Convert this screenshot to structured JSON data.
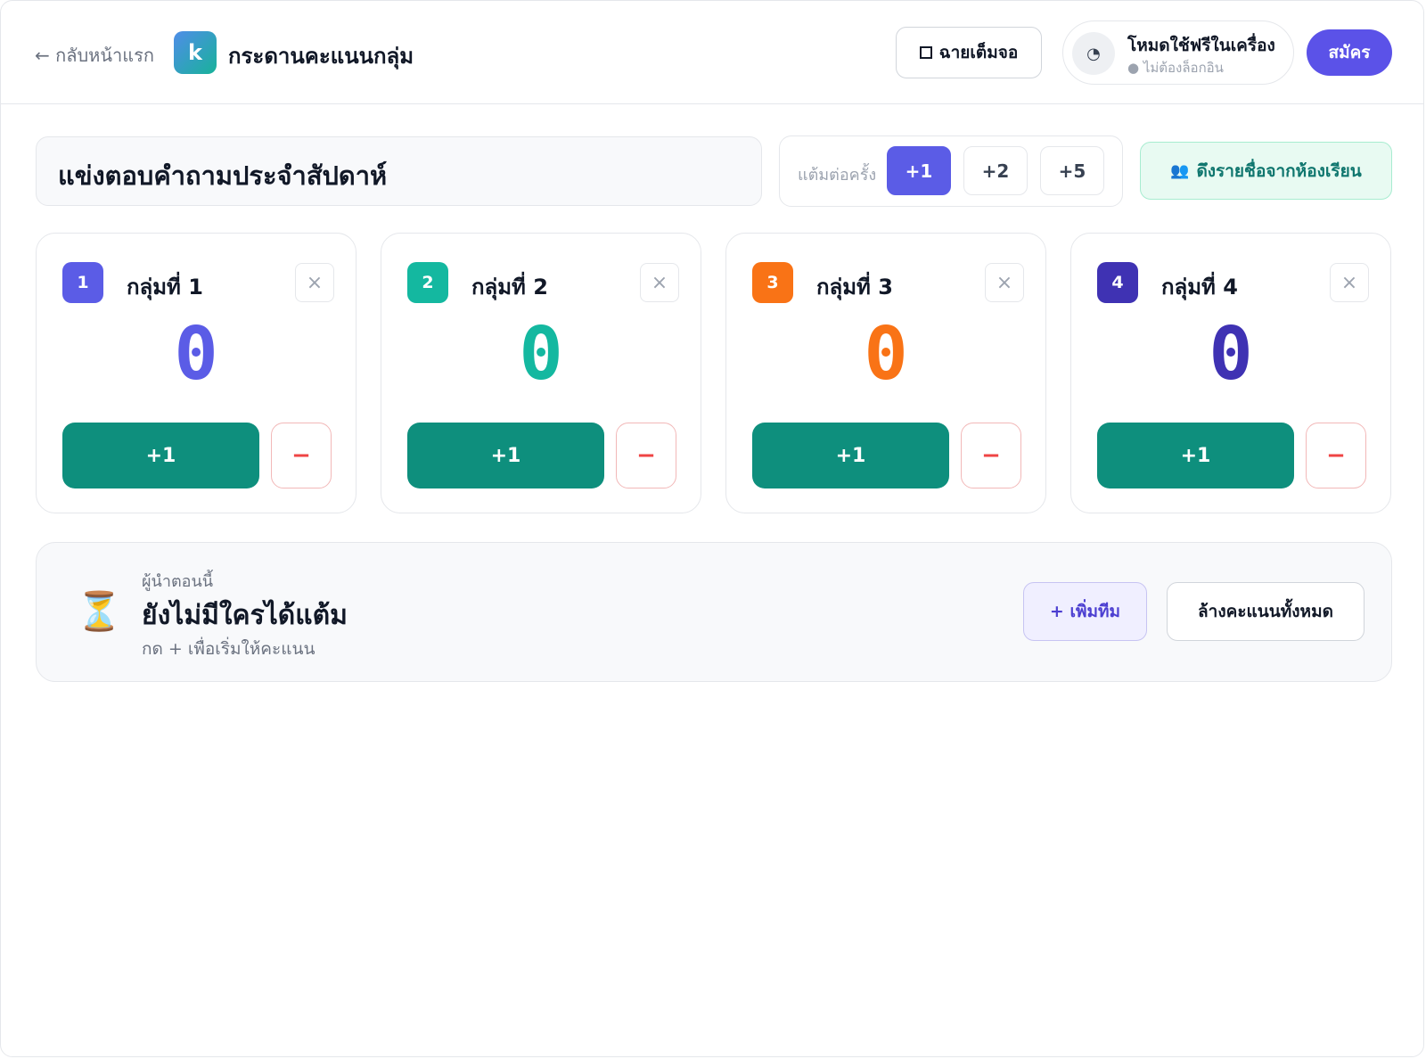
{
  "header": {
    "back_label": "← กลับหน้าแรก",
    "logo_letter": "k",
    "title": "กระดานคะแนนกลุ่ม",
    "fullscreen_label": "ฉายเต็มจอ",
    "mode_icon": "◔",
    "mode_title": "โหมดใช้ฟรีในเครื่อง",
    "mode_sub": "● ไม่ต้องล็อกอิน",
    "signup_label": "สมัคร"
  },
  "toolbar": {
    "board_title": "แข่งตอบคำถามประจำสัปดาห์",
    "points_label": "แต้มต่อครั้ง",
    "point_options": [
      "+1",
      "+2",
      "+5"
    ],
    "selected_point": "+1",
    "import_icon": "👥",
    "import_label": "ดึงรายชื่อจากห้องเรียน"
  },
  "teams": [
    {
      "number": "1",
      "name": "กลุ่มที่ 1",
      "score": "0",
      "color": "#5b5ce6",
      "plus_label": "+1",
      "minus_label": "−",
      "close_icon": "×"
    },
    {
      "number": "2",
      "name": "กลุ่มที่ 2",
      "score": "0",
      "color": "#14b8a0",
      "plus_label": "+1",
      "minus_label": "−",
      "close_icon": "×"
    },
    {
      "number": "3",
      "name": "กลุ่มที่ 3",
      "score": "0",
      "color": "#f97316",
      "plus_label": "+1",
      "minus_label": "−",
      "close_icon": "×"
    },
    {
      "number": "4",
      "name": "กลุ่มที่ 4",
      "score": "0",
      "color": "#3f32b3",
      "plus_label": "+1",
      "minus_label": "−",
      "close_icon": "×"
    }
  ],
  "leader": {
    "icon": "⏳",
    "label": "ผู้นำตอนนี้",
    "main": "ยังไม่มีใครได้แต้ม",
    "hint": "กด + เพื่อเริ่มให้คะแนน",
    "add_team_label": "+ เพิ่มทีม",
    "reset_label": "ล้างคะแนนทั้งหมด"
  },
  "colors": {
    "accent": "#5b5ce6",
    "primary_green": "#0e8f7d",
    "danger": "#ef4444"
  }
}
